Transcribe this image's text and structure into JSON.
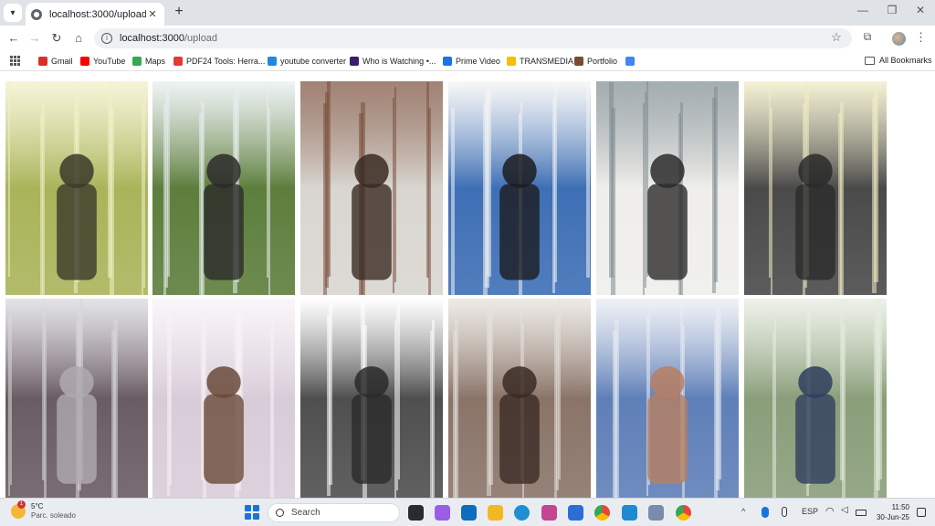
{
  "browser": {
    "tab": {
      "title": "localhost:3000/upload",
      "favicon": "globe-icon",
      "close": "✕"
    },
    "new_tab": "+",
    "window_controls": {
      "minimize": "—",
      "maximize": "❐",
      "close": "✕"
    },
    "address": {
      "host": "localhost:3000",
      "path": "/upload"
    },
    "bookmarks": [
      {
        "label": "Gmail",
        "icon": "gmail-icon",
        "color": "#d93025"
      },
      {
        "label": "YouTube",
        "icon": "youtube-icon",
        "color": "#ff0000"
      },
      {
        "label": "Maps",
        "icon": "maps-icon",
        "color": "#34a853"
      },
      {
        "label": "PDF24 Tools: Herra...",
        "icon": "pdf24-icon",
        "color": "#e53935"
      },
      {
        "label": "youtube converter",
        "icon": "converter-icon",
        "color": "#1e88e5"
      },
      {
        "label": "Who is Watching •...",
        "icon": "max-icon",
        "color": "#3b1c6e"
      },
      {
        "label": "Prime Video",
        "icon": "prime-video-icon",
        "color": "#1a73e8"
      },
      {
        "label": "TRANSMEDIA",
        "icon": "drive-icon",
        "color": "#fbbc04"
      },
      {
        "label": "Portfolio",
        "icon": "portfolio-icon",
        "color": "#7a4b32"
      },
      {
        "label": "",
        "icon": "docs-icon",
        "color": "#4285f4"
      }
    ],
    "all_bookmarks": "All Bookmarks"
  },
  "gallery": {
    "images": [
      {
        "name": "photo-1",
        "bg": "#a9b45a",
        "accent": "#f2f0c8",
        "figure": "#3a3a2a"
      },
      {
        "name": "photo-2",
        "bg": "#5d7e3c",
        "accent": "#e8eef0",
        "figure": "#2b2b2b"
      },
      {
        "name": "photo-3",
        "bg": "#d9d6d1",
        "accent": "#7a4e3a",
        "figure": "#3a2a22"
      },
      {
        "name": "photo-4",
        "bg": "#3e6fb5",
        "accent": "#f4f4f4",
        "figure": "#1c1b1f"
      },
      {
        "name": "photo-5",
        "bg": "#efeeea",
        "accent": "#7d8a8f",
        "figure": "#2c2a2a"
      },
      {
        "name": "photo-6",
        "bg": "#4a4a4a",
        "accent": "#f1ecc4",
        "figure": "#2a2a2a"
      },
      {
        "name": "photo-7",
        "bg": "#6a5c63",
        "accent": "#d9d8dd",
        "figure": "#b0aab0"
      },
      {
        "name": "photo-8",
        "bg": "#d8ccd8",
        "accent": "#f7f2f6",
        "figure": "#6a4a3a"
      },
      {
        "name": "photo-9",
        "bg": "#4e4f4e",
        "accent": "#ffffff",
        "figure": "#2a2a2a"
      },
      {
        "name": "photo-10",
        "bg": "#8a7468",
        "accent": "#e6e2dc",
        "figure": "#3a2a24"
      },
      {
        "name": "photo-11",
        "bg": "#5f7fb8",
        "accent": "#e9ecf3",
        "figure": "#b87f62"
      },
      {
        "name": "photo-12",
        "bg": "#8a9e7a",
        "accent": "#e6ece0",
        "figure": "#2f3e5e"
      }
    ]
  },
  "taskbar": {
    "weather": {
      "temp": "5°C",
      "condition": "Parc. soleado",
      "badge": "1"
    },
    "search_placeholder": "Search",
    "apps": [
      {
        "name": "taskview-icon",
        "color": "#2b2b2b"
      },
      {
        "name": "copilot-icon",
        "color": "#9b5de5"
      },
      {
        "name": "outlook-icon",
        "color": "#0f6cbd"
      },
      {
        "name": "file-explorer-icon",
        "color": "#f2b824"
      },
      {
        "name": "edge-icon",
        "color": "#1e8fd1"
      },
      {
        "name": "photos-icon",
        "color": "#c3468f"
      },
      {
        "name": "store-icon",
        "color": "#2b6ed6"
      },
      {
        "name": "chrome-icon",
        "color": "#e8453c"
      },
      {
        "name": "vscode-icon",
        "color": "#1f8ad2"
      },
      {
        "name": "network-app-icon",
        "color": "#7a8cab"
      },
      {
        "name": "chrome-active-icon",
        "color": "#e8453c"
      }
    ],
    "tray": {
      "chevron": "^",
      "lang": "ESP"
    },
    "clock": {
      "time": "11:50",
      "date": "30-Jun-25"
    }
  }
}
